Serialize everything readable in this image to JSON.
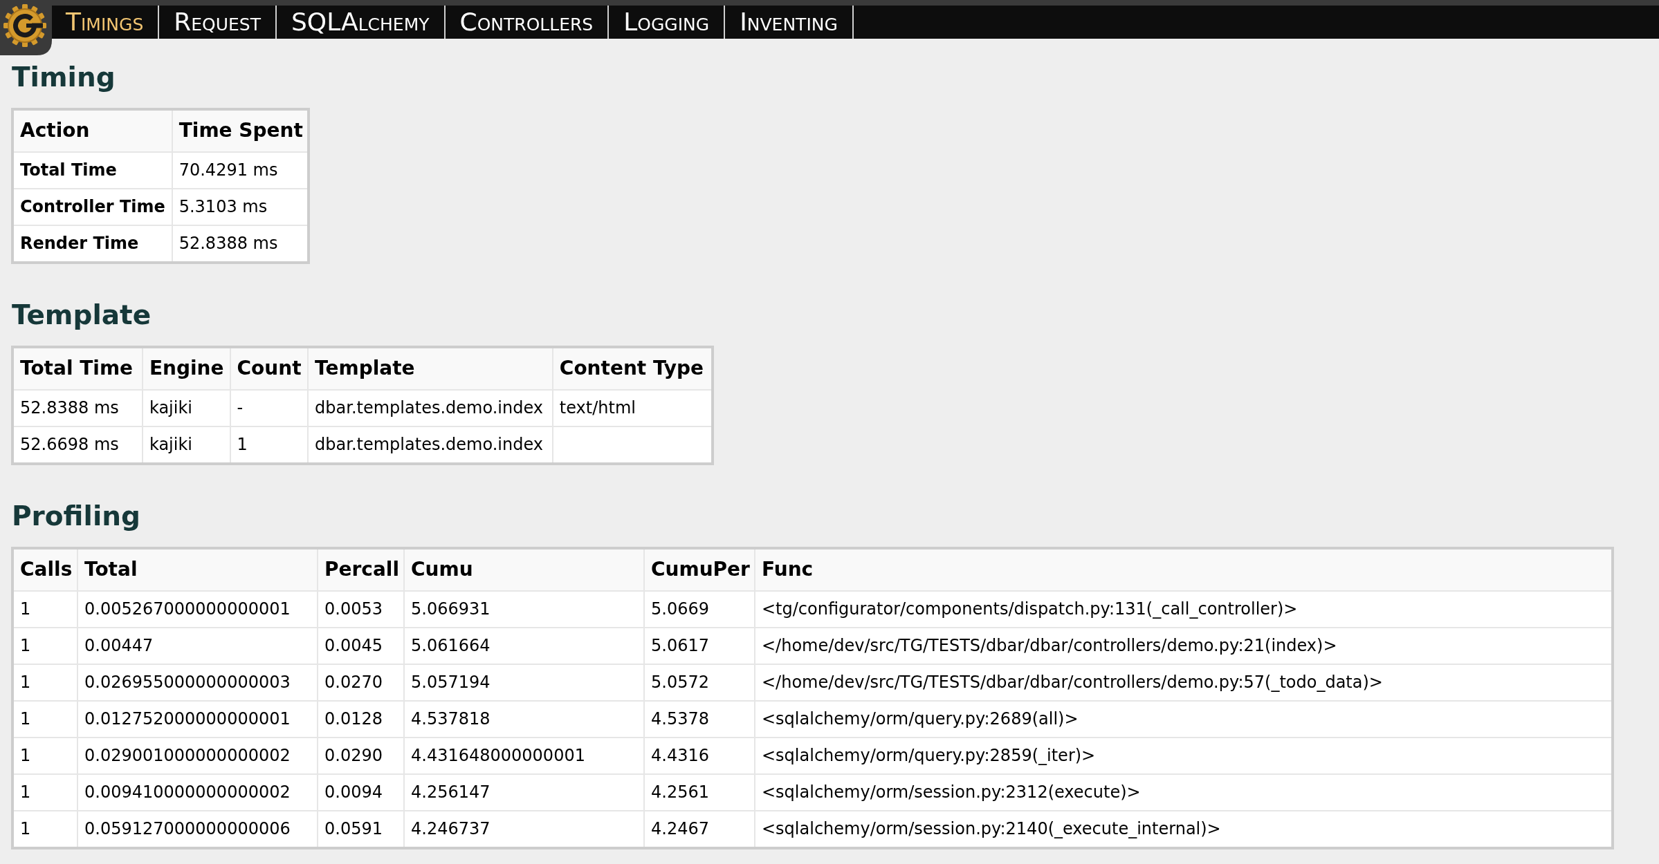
{
  "nav": {
    "tabs": [
      {
        "label": "Timings",
        "selected": true
      },
      {
        "label": "Request",
        "selected": false
      },
      {
        "label": "SQLAlchemy",
        "selected": false
      },
      {
        "label": "Controllers",
        "selected": false
      },
      {
        "label": "Logging",
        "selected": false
      },
      {
        "label": "Inventing",
        "selected": false
      }
    ]
  },
  "sections": [
    {
      "title": "Timing",
      "kind": "summary",
      "columns": [
        "Action",
        "Time Spent"
      ],
      "rows": [
        [
          "Total Time",
          "70.4291 ms"
        ],
        [
          "Controller Time",
          "5.3103 ms"
        ],
        [
          "Render Time",
          "52.8388 ms"
        ]
      ]
    },
    {
      "title": "Template",
      "kind": "grid",
      "columns": [
        "Total Time",
        "Engine",
        "Count",
        "Template",
        "Content Type"
      ],
      "rows": [
        [
          "52.8388 ms",
          "kajiki",
          "-",
          "dbar.templates.demo.index",
          "text/html"
        ],
        [
          "52.6698 ms",
          "kajiki",
          "1",
          "dbar.templates.demo.index"
        ]
      ]
    },
    {
      "title": "Profiling",
      "kind": "grid",
      "columns": [
        "Calls",
        "Total",
        "Percall",
        "Cumu",
        "CumuPer",
        "Func"
      ],
      "rows": [
        [
          "1",
          "0.005267000000000001",
          "0.0053",
          "5.066931",
          "5.0669",
          "<tg/configurator/components/dispatch.py:131(_call_controller)>"
        ],
        [
          "1",
          "0.00447",
          "0.0045",
          "5.061664",
          "5.0617",
          "</home/dev/src/TG/TESTS/dbar/dbar/controllers/demo.py:21(index)>"
        ],
        [
          "1",
          "0.026955000000000003",
          "0.0270",
          "5.057194",
          "5.0572",
          "</home/dev/src/TG/TESTS/dbar/dbar/controllers/demo.py:57(_todo_data)>"
        ],
        [
          "1",
          "0.012752000000000001",
          "0.0128",
          "4.537818",
          "4.5378",
          "<sqlalchemy/orm/query.py:2689(all)>"
        ],
        [
          "1",
          "0.029001000000000002",
          "0.0290",
          "4.431648000000001",
          "4.4316",
          "<sqlalchemy/orm/query.py:2859(_iter)>"
        ],
        [
          "1",
          "0.009410000000000002",
          "0.0094",
          "4.256147",
          "4.2561",
          "<sqlalchemy/orm/session.py:2312(execute)>"
        ],
        [
          "1",
          "0.059127000000000006",
          "0.0591",
          "4.246737",
          "4.2467",
          "<sqlalchemy/orm/session.py:2140(_execute_internal)>"
        ]
      ]
    }
  ]
}
